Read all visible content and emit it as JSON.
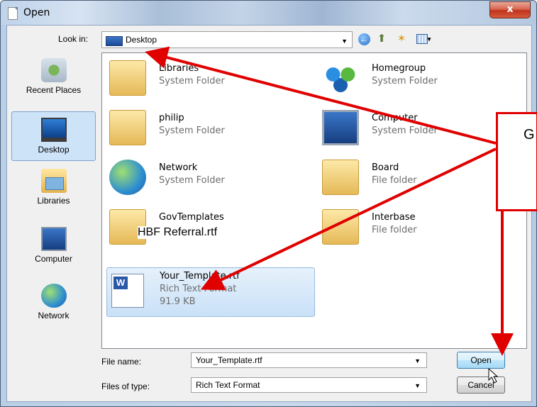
{
  "window": {
    "title": "Open",
    "close_label": "x"
  },
  "lookin": {
    "label": "Look in:",
    "value": "Desktop"
  },
  "toolbar": {
    "back_glyph": "←",
    "up_glyph": "⬆",
    "newfolder_glyph": "✶",
    "views_dd": "▾"
  },
  "places": [
    {
      "label": "Recent Places"
    },
    {
      "label": "Desktop"
    },
    {
      "label": "Libraries"
    },
    {
      "label": "Computer"
    },
    {
      "label": "Network"
    }
  ],
  "files": [
    {
      "name": "Libraries",
      "type": "System Folder"
    },
    {
      "name": "Homegroup",
      "type": "System Folder"
    },
    {
      "name": "philip",
      "type": "System Folder"
    },
    {
      "name": "Computer",
      "type": "System Folder"
    },
    {
      "name": "Network",
      "type": "System Folder"
    },
    {
      "name": "Board",
      "type": "File folder"
    },
    {
      "name": "GovTemplates",
      "type": ""
    },
    {
      "name": "Interbase",
      "type": "File folder"
    },
    {
      "name": "Your_Template.rtf",
      "type": "Rich Text Format",
      "size": "91.9 KB"
    }
  ],
  "overlay_label": "HBF Referral.rtf",
  "filename": {
    "label": "File name:",
    "value": "Your_Template.rtf"
  },
  "filetype": {
    "label": "Files of type:",
    "value": "Rich Text Format"
  },
  "buttons": {
    "open": "Open",
    "cancel": "Cancel"
  },
  "callout": {
    "text": "G"
  },
  "colors": {
    "annotation_red": "#e00000",
    "selection_blue": "#cde3f8"
  }
}
